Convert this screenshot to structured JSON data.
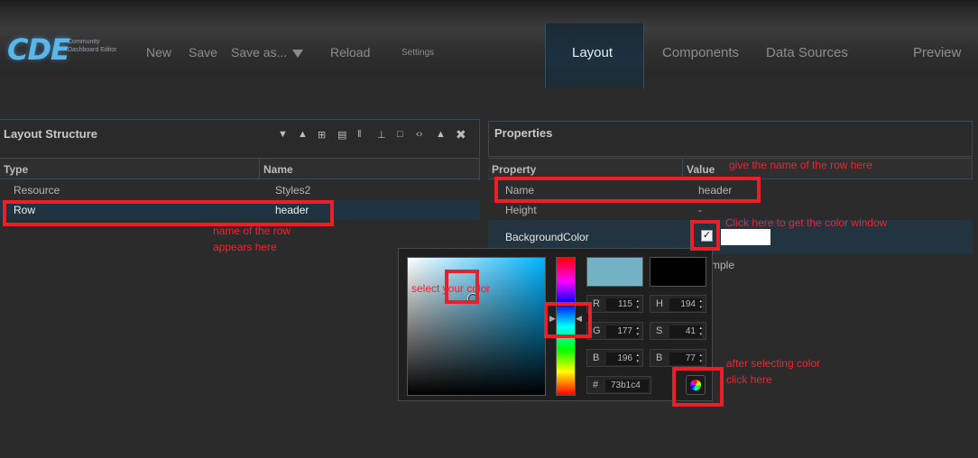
{
  "logo": {
    "brand": "CDE",
    "subtitle": "Community Dashboard Editor"
  },
  "menu": {
    "new": "New",
    "save": "Save",
    "save_as": "Save as...",
    "reload": "Reload",
    "settings": "Settings"
  },
  "tabs": {
    "layout": "Layout",
    "components": "Components",
    "data_sources": "Data Sources",
    "preview": "Preview"
  },
  "layout_structure": {
    "title": "Layout Structure",
    "columns": [
      "Type",
      "Name"
    ],
    "rows": [
      {
        "type": "Resource",
        "name": "Styles2"
      },
      {
        "type": "Row",
        "name": "header"
      }
    ]
  },
  "properties": {
    "title": "Properties",
    "columns": [
      "Property",
      "Value"
    ],
    "rows": [
      {
        "property": "Name",
        "value": "header"
      },
      {
        "property": "Height",
        "value": "-"
      },
      {
        "property": "BackgroundColor",
        "value": "✓"
      }
    ],
    "partial_text": "mple"
  },
  "color_picker": {
    "new_color": "#73b1c4",
    "current_color": "#000000",
    "r": {
      "label": "R",
      "value": "115"
    },
    "g": {
      "label": "G",
      "value": "177"
    },
    "b": {
      "label": "B",
      "value": "196"
    },
    "h": {
      "label": "H",
      "value": "194"
    },
    "s": {
      "label": "S",
      "value": "41"
    },
    "v": {
      "label": "B",
      "value": "77"
    },
    "hex": {
      "label": "#",
      "value": "73b1c4"
    }
  },
  "annotations": {
    "row_name_note": "name of the row appears here",
    "name_note": "give the name of the row here",
    "color_window_note": "Click here to get the color window",
    "select_color_note": "select your color",
    "after_select_note": "after selecting color click here"
  },
  "colors": {
    "accent_red": "#e8202a",
    "selected_row": "#1f3342",
    "logo_blue": "#5cb6e8"
  }
}
